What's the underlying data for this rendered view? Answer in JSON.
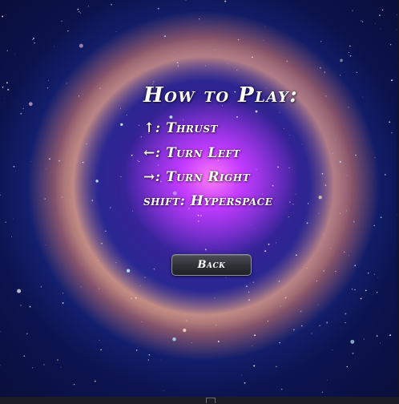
{
  "how_to_play": {
    "title": "How to Play:",
    "controls": [
      {
        "text": "↑: Thrust"
      },
      {
        "text": "←: Turn Left"
      },
      {
        "text": "→: Turn Right"
      },
      {
        "text": "shift: Hyperspace"
      }
    ]
  },
  "back_button": {
    "label": "Back"
  },
  "background": {
    "theme": "nebula-starfield",
    "colors": {
      "deep_space": "#0d1450",
      "ring_glow": "#f0aa82",
      "core": "#c33bff",
      "text": "#ffffff",
      "button": "#2e3036"
    }
  }
}
